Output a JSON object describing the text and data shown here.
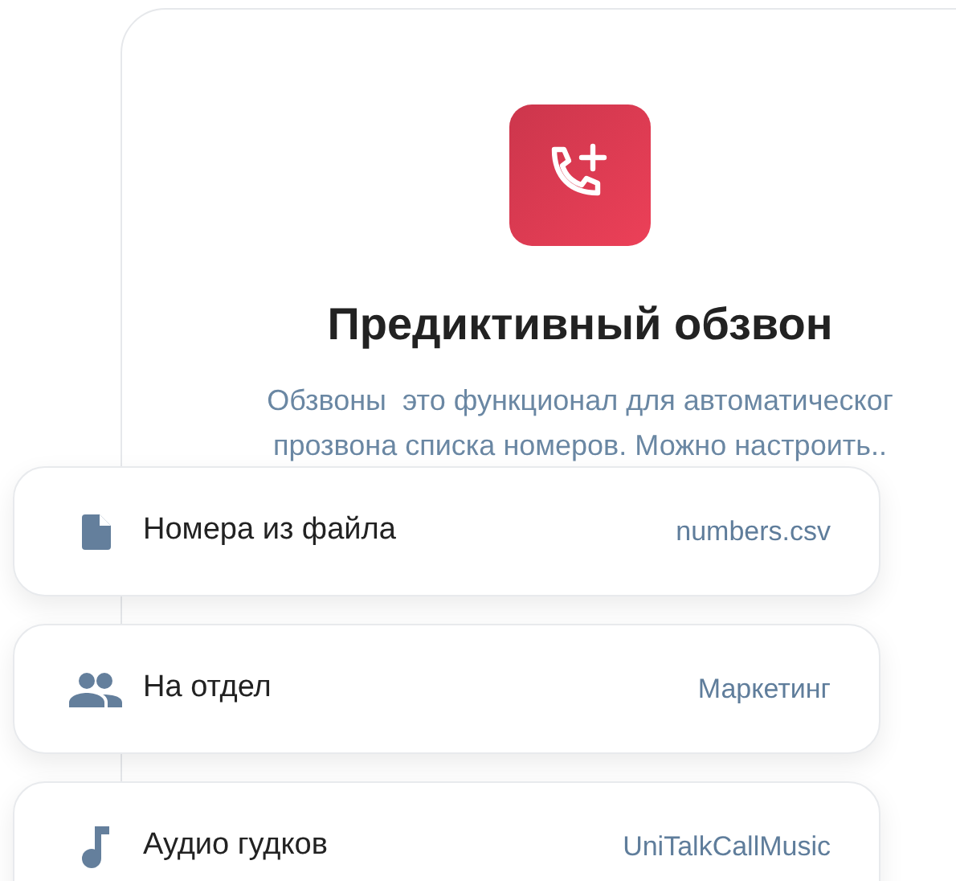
{
  "card": {
    "title": "Предиктивный обзвон",
    "description_lines": [
      "Обзвоны  это функционал для автоматическог",
      "прозвона списка номеров. Можно настроить.."
    ]
  },
  "settings": [
    {
      "kind": "file",
      "label": "Номера из файла",
      "value": "numbers.csv"
    },
    {
      "kind": "group",
      "label": "На отдел",
      "value": "Маркетинг"
    },
    {
      "kind": "music",
      "label": "Аудио гудков",
      "value": "UniTalkCallMusic"
    }
  ]
}
